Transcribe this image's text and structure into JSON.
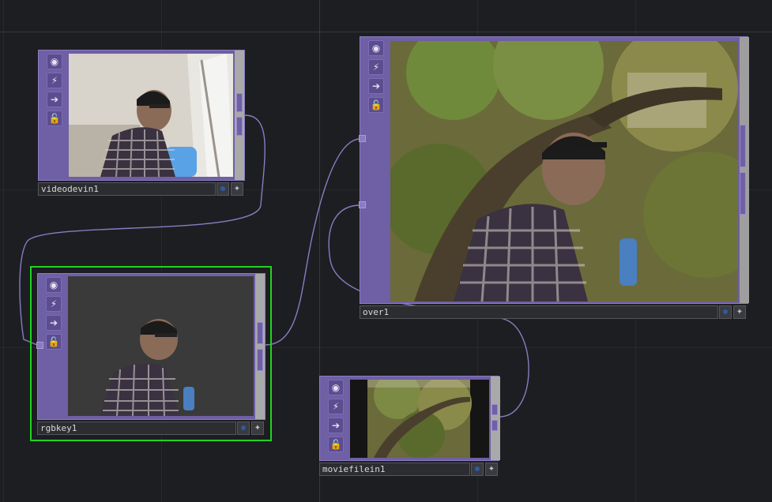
{
  "nodes": {
    "videodevin": {
      "name": "videodevin1"
    },
    "rgbkey": {
      "name": "rgbkey1"
    },
    "over": {
      "name": "over1"
    },
    "moviefilein": {
      "name": "moviefilein1"
    }
  },
  "icons": [
    "viewer-icon",
    "cook-icon",
    "export-icon",
    "lock-icon",
    "display-dot-icon",
    "compass-icon"
  ],
  "colors": {
    "background": "#1d1e22",
    "node_purple": "#6f5fa4",
    "wire": "#8a7cc0",
    "selection": "#1fd41f"
  }
}
